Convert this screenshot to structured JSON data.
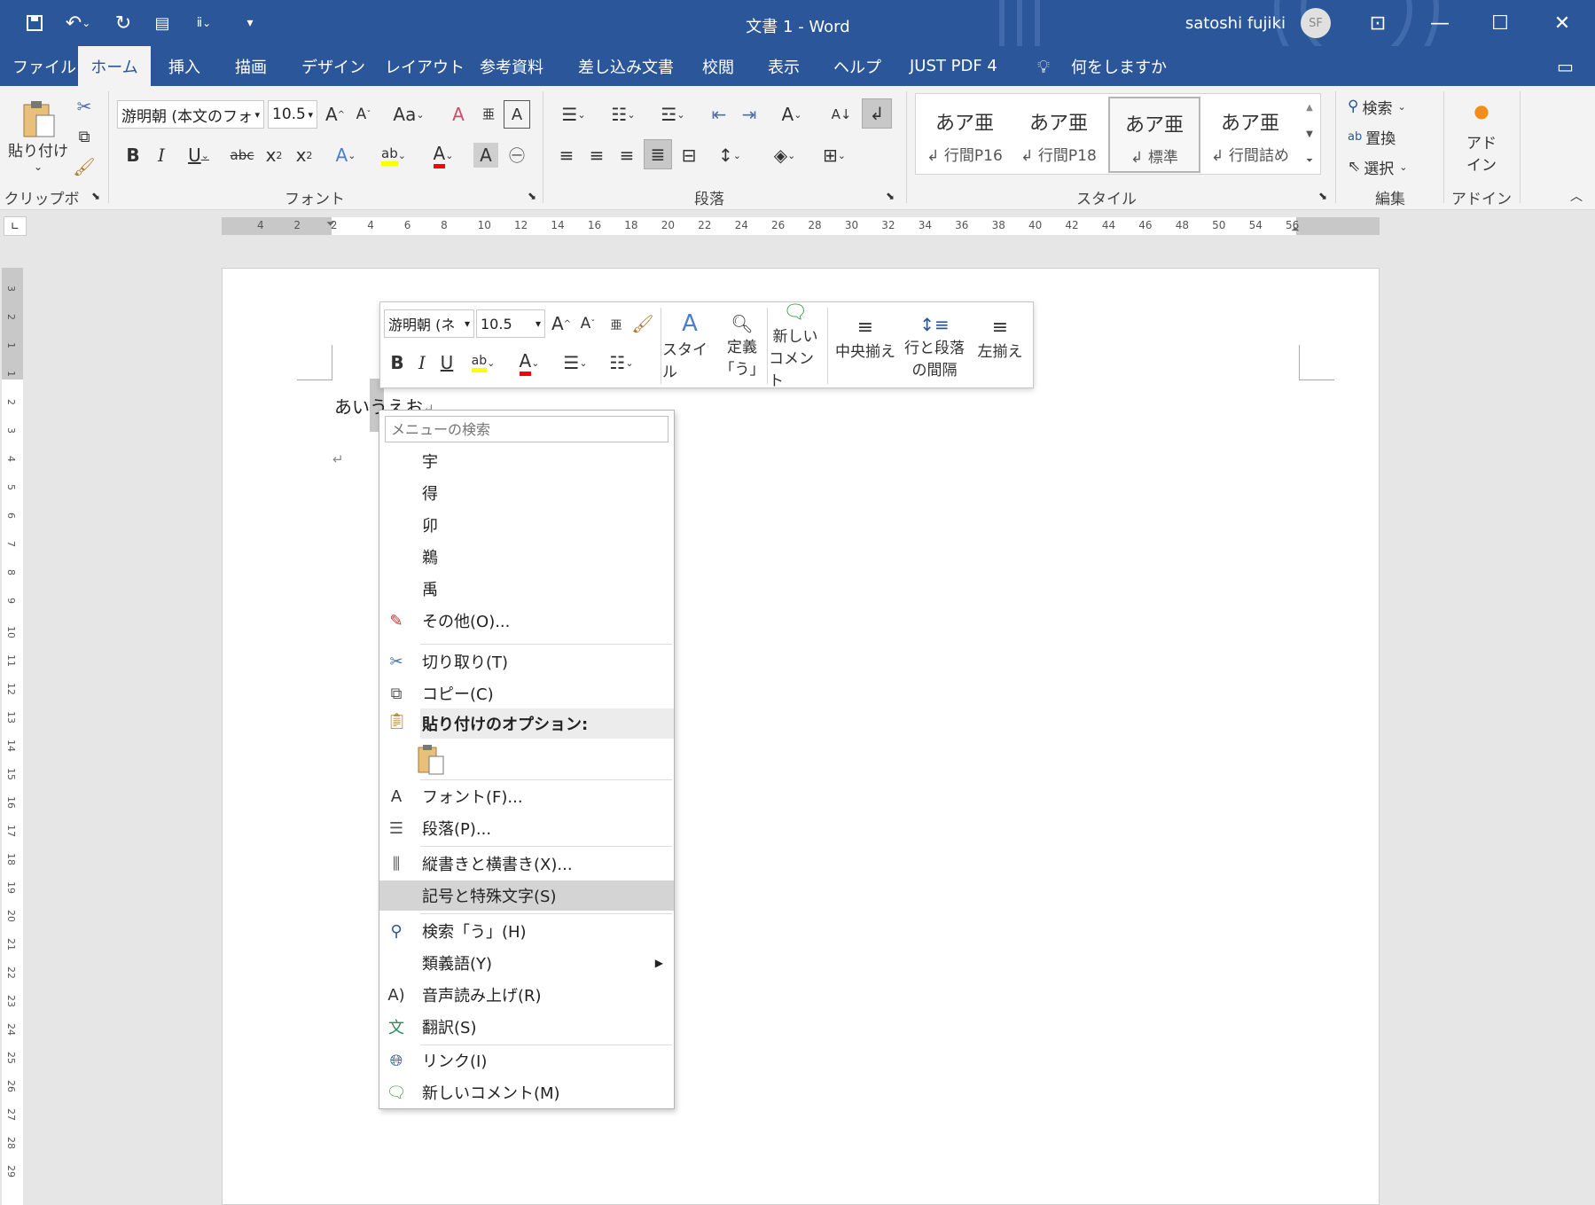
{
  "titlebar": {
    "title": "文書 1  -  Word",
    "user_name": "satoshi fujiki",
    "user_initials": "SF",
    "qat_icons": [
      "save-icon",
      "undo-icon",
      "redo-icon",
      "touch-mode-icon",
      "furigana-icon",
      "customize-icon"
    ]
  },
  "tabs": [
    {
      "label": "ファイル"
    },
    {
      "label": "ホーム"
    },
    {
      "label": "挿入"
    },
    {
      "label": "描画"
    },
    {
      "label": "デザイン"
    },
    {
      "label": "レイアウト"
    },
    {
      "label": "参考資料"
    },
    {
      "label": "差し込み文書"
    },
    {
      "label": "校閲"
    },
    {
      "label": "表示"
    },
    {
      "label": "ヘルプ"
    },
    {
      "label": "JUST PDF 4"
    }
  ],
  "tell_me": "何をしますか",
  "ribbon": {
    "clipboard": {
      "paste_label": "貼り付け",
      "group_label": "クリップボード"
    },
    "font": {
      "font_name": "游明朝 (本文のフォ",
      "font_size": "10.5",
      "group_label": "フォント"
    },
    "paragraph": {
      "group_label": "段落"
    },
    "styles": {
      "items": [
        {
          "big": "あア亜",
          "small": "↲ 行間P16"
        },
        {
          "big": "あア亜",
          "small": "↲ 行間P18"
        },
        {
          "big": "あア亜",
          "small": "↲ 標準"
        },
        {
          "big": "あア亜",
          "small": "↲ 行間詰め"
        }
      ],
      "group_label": "スタイル"
    },
    "editing": {
      "find": "検索",
      "replace": "置換",
      "select": "選択",
      "group_label": "編集"
    },
    "addin": {
      "label_line1": "アド",
      "label_line2": "イン",
      "group_label": "アドイン"
    }
  },
  "ruler": {
    "h_ticks": [
      "4",
      "2",
      "2",
      "4",
      "6",
      "8",
      "10",
      "12",
      "14",
      "16",
      "18",
      "20",
      "22",
      "24",
      "26",
      "28",
      "30",
      "32",
      "34",
      "36",
      "38",
      "40",
      "42",
      "44",
      "46",
      "48",
      "50",
      "54",
      "56"
    ],
    "v_ticks": [
      "3",
      "2",
      "1",
      "1",
      "2",
      "3",
      "4",
      "5",
      "6",
      "7",
      "8",
      "9",
      "10",
      "11",
      "12",
      "13",
      "14",
      "15",
      "16",
      "17",
      "18",
      "19",
      "20",
      "21",
      "22",
      "23",
      "24",
      "25",
      "26",
      "27",
      "28",
      "29"
    ]
  },
  "document": {
    "text": "あいうえお",
    "return_mark": "↵"
  },
  "mini_toolbar": {
    "font_name": "游明朝 (ネ",
    "font_size": "10.5",
    "style_label": "スタイル",
    "define_line1": "定義",
    "define_line2": "「う」",
    "comment_line1": "新しい",
    "comment_line2": "コメント",
    "center_label": "中央揃え",
    "spacing_line1": "行と段落",
    "spacing_line2": "の間隔",
    "left_label": "左揃え"
  },
  "context_menu": {
    "search_placeholder": "メニューの検索",
    "candidates": [
      "宇",
      "得",
      "卯",
      "鵜",
      "禹"
    ],
    "items": [
      {
        "label": "その他(O)..."
      },
      {
        "label": "切り取り(T)"
      },
      {
        "label": "コピー(C)"
      },
      {
        "label": "貼り付けのオプション:"
      },
      {
        "label": "フォント(F)..."
      },
      {
        "label": "段落(P)..."
      },
      {
        "label": "縦書きと横書き(X)..."
      },
      {
        "label": "記号と特殊文字(S)"
      },
      {
        "label": "検索「う」(H)"
      },
      {
        "label": "類義語(Y)"
      },
      {
        "label": "音声読み上げ(R)"
      },
      {
        "label": "翻訳(S)"
      },
      {
        "label": "リンク(I)"
      },
      {
        "label": "新しいコメント(M)"
      }
    ]
  },
  "colors": {
    "accent": "#2b579a",
    "highlight": "#ffff00",
    "font_color": "#ff0000"
  }
}
